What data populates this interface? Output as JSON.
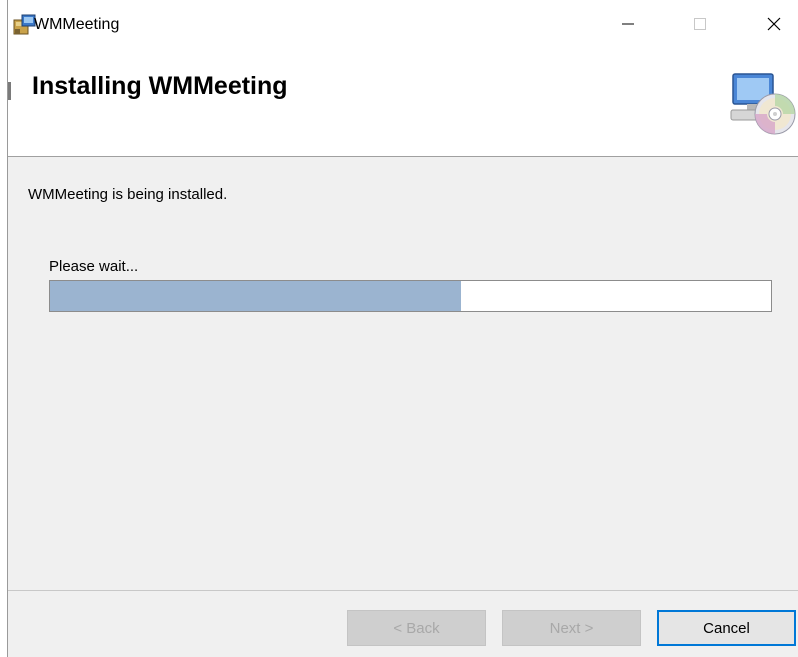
{
  "window": {
    "title": "WMMeeting"
  },
  "header": {
    "title": "Installing WMMeeting"
  },
  "content": {
    "status": "WMMeeting is being installed.",
    "wait_label": "Please wait...",
    "progress_percent": 57
  },
  "buttons": {
    "back": "< Back",
    "next": "Next >",
    "cancel": "Cancel"
  },
  "colors": {
    "progress_fill": "#9bb4d0",
    "focus_border": "#0078d7"
  },
  "icons": {
    "app": "installer-package-icon",
    "header": "computer-with-cd-icon",
    "minimize": "minimize-icon",
    "maximize": "maximize-icon",
    "close": "close-icon"
  }
}
